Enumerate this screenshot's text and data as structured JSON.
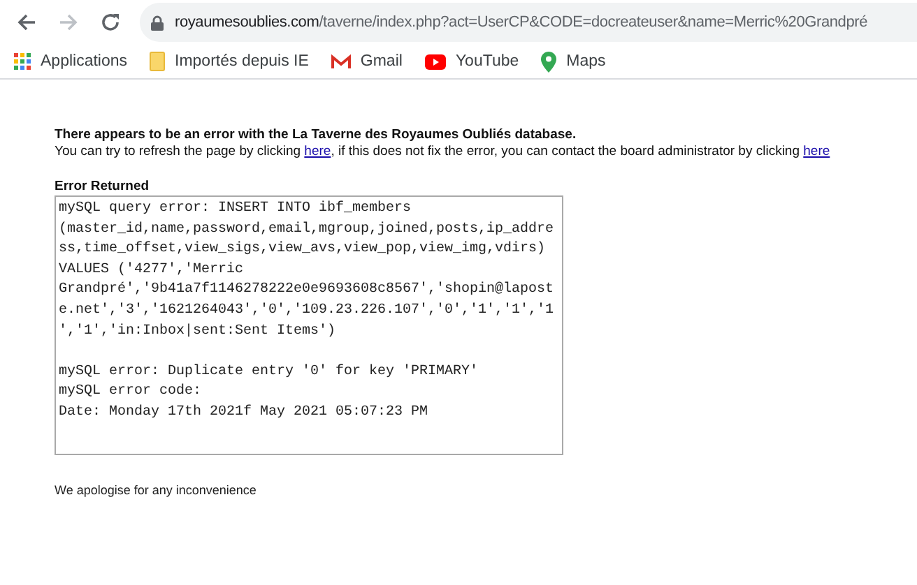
{
  "browser": {
    "url_host": "royaumesoublies.com",
    "url_path": "/taverne/index.php?act=UserCP&CODE=docreateuser&name=Merric%20Grandpré",
    "bookmarks": [
      {
        "kind": "apps",
        "label": "Applications"
      },
      {
        "kind": "folder",
        "label": "Importés depuis IE"
      },
      {
        "kind": "gmail",
        "label": "Gmail"
      },
      {
        "kind": "youtube",
        "label": "YouTube"
      },
      {
        "kind": "maps",
        "label": "Maps"
      }
    ]
  },
  "page": {
    "heading": "There appears to be an error with the La Taverne des Royaumes Oubliés database.",
    "message_parts": [
      {
        "kind": "text",
        "text": "You can try to refresh the page by clicking "
      },
      {
        "kind": "link",
        "text": "here"
      },
      {
        "kind": "text",
        "text": ", if this does not fix the error, you can contact the board administrator by clicking "
      },
      {
        "kind": "link",
        "text": "here"
      }
    ],
    "error_label": "Error Returned",
    "error_blocks": [
      [
        "mySQL query error: INSERT INTO ibf_members",
        "(master_id,name,password,email,mgroup,joined,posts,ip_addre",
        "ss,time_offset,view_sigs,view_avs,view_pop,view_img,vdirs)",
        "VALUES ('4277','Merric",
        "Grandpré','9b41a7f1146278222e0e9693608c8567','shopin@lapost",
        "e.net','3','1621264043','0','109.23.226.107','0','1','1','1",
        "','1','in:Inbox|sent:Sent Items')"
      ],
      [
        "mySQL error: Duplicate entry '0' for key 'PRIMARY'",
        "mySQL error code:",
        "Date: Monday 17th 2021f May 2021 05:07:23 PM"
      ]
    ],
    "footer": "We apologise for any inconvenience"
  }
}
